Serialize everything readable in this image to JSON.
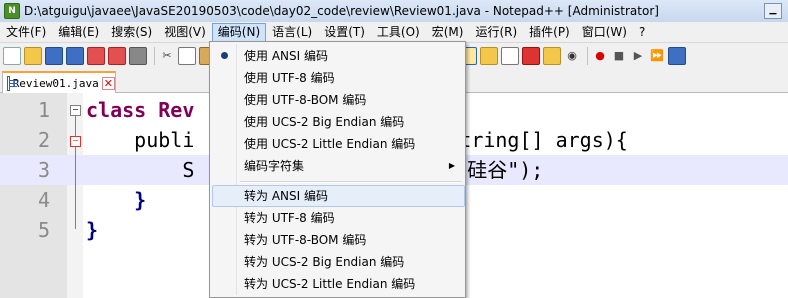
{
  "window": {
    "title": "D:\\atguigu\\javaee\\JavaSE20190503\\code\\day02_code\\review\\Review01.java - Notepad++ [Administrator]"
  },
  "menubar": [
    {
      "label": "文件(F)"
    },
    {
      "label": "编辑(E)"
    },
    {
      "label": "搜索(S)"
    },
    {
      "label": "视图(V)"
    },
    {
      "label": "编码(N)"
    },
    {
      "label": "语言(L)"
    },
    {
      "label": "设置(T)"
    },
    {
      "label": "工具(O)"
    },
    {
      "label": "宏(M)"
    },
    {
      "label": "运行(R)"
    },
    {
      "label": "插件(P)"
    },
    {
      "label": "窗口(W)"
    },
    {
      "label": "?"
    }
  ],
  "tab": {
    "label": "Review01.java",
    "close": "✕"
  },
  "editor": {
    "lines": [
      {
        "num": "1",
        "text": "class Rev"
      },
      {
        "num": "2",
        "text": "    publi                  in(String[] args){"
      },
      {
        "num": "3",
        "text": "        S                  n(\"尚硅谷\");"
      },
      {
        "num": "4",
        "text": "    }"
      },
      {
        "num": "5",
        "text": "}"
      }
    ]
  },
  "encoding_menu": {
    "items": [
      {
        "label": "使用 ANSI 编码",
        "selected": true
      },
      {
        "label": "使用 UTF-8 编码"
      },
      {
        "label": "使用 UTF-8-BOM 编码"
      },
      {
        "label": "使用 UCS-2 Big Endian 编码"
      },
      {
        "label": "使用 UCS-2 Little Endian 编码"
      },
      {
        "label": "编码字符集",
        "submenu_arrow": "▶"
      },
      {
        "label": "转为 ANSI 编码"
      },
      {
        "label": "转为 UTF-8 编码"
      },
      {
        "label": "转为 UTF-8-BOM 编码"
      },
      {
        "label": "转为 UCS-2 Big Endian 编码"
      },
      {
        "label": "转为 UCS-2 Little Endian 编码"
      }
    ]
  },
  "icons": {
    "toolbar": [
      "new-file-icon",
      "open-file-icon",
      "save-icon",
      "save-all-icon",
      "close-icon",
      "close-all-icon",
      "print-icon",
      "cut-icon",
      "copy-icon",
      "paste-icon",
      "undo-icon",
      "redo-icon",
      "find-icon",
      "replace-icon",
      "zoom-in-icon",
      "zoom-out-icon",
      "sync-v-icon",
      "sync-h-icon",
      "word-wrap-icon",
      "show-all-chars-icon",
      "indent-guide-icon",
      "user-lang-icon",
      "doc-map-icon",
      "function-list-icon",
      "folder-workspace-icon",
      "monitoring-icon",
      "record-macro-icon",
      "stop-record-icon",
      "play-macro-icon",
      "play-multiple-icon",
      "save-macro-icon"
    ]
  }
}
